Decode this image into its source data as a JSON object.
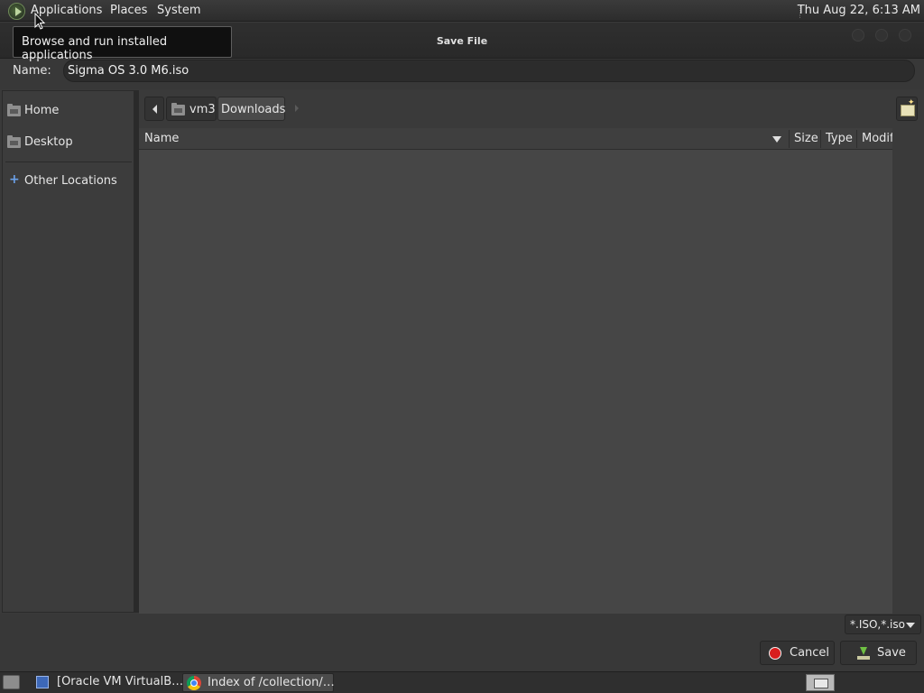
{
  "top_panel": {
    "menu": [
      "Applications",
      "Places",
      "System"
    ],
    "clock": "Thu Aug 22,  6:13 AM"
  },
  "tooltip": "Browse and run installed applications",
  "dialog": {
    "title": "Save File",
    "name_label": "Name:",
    "name_value": "Sigma OS 3.0 M6.iso",
    "sidebar": {
      "items": [
        {
          "label": "Home",
          "icon": "home-folder-icon"
        },
        {
          "label": "Desktop",
          "icon": "desktop-folder-icon"
        },
        {
          "label": "Other Locations",
          "icon": "plus-icon"
        }
      ]
    },
    "path": [
      "vm3",
      "Downloads"
    ],
    "columns": [
      "Name",
      "Size",
      "Type",
      "Modif"
    ],
    "filter": "*.ISO,*.iso",
    "cancel_label": "Cancel",
    "save_label": "Save"
  },
  "taskbar": {
    "items": [
      {
        "label": "[Oracle VM VirtualB…",
        "icon": "virtualbox-icon"
      },
      {
        "label": "Index of /collection/…",
        "icon": "chrome-icon"
      }
    ]
  },
  "colors": {
    "background": "#3a3a3a",
    "cancel_icon": "#d81e1e",
    "save_icon": "#6fc043",
    "link_accent": "#6aa0e8"
  }
}
